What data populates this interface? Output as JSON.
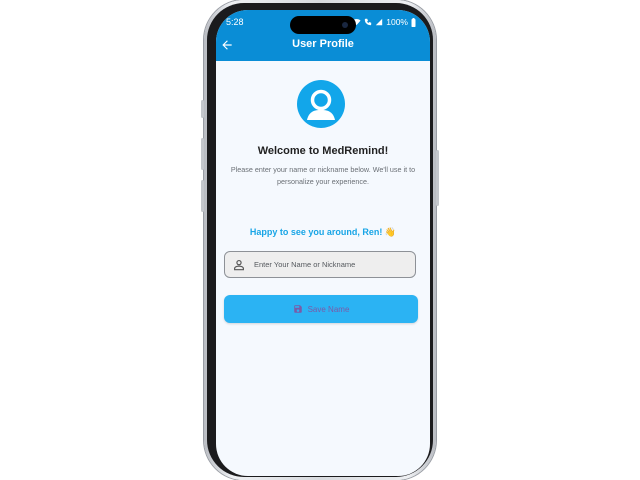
{
  "status_bar": {
    "time": "5:28",
    "battery": "100%"
  },
  "app_bar": {
    "title": "User Profile",
    "back_icon": "arrow-left-icon",
    "color": "#0a8dd6"
  },
  "profile": {
    "avatar_icon": "person-icon",
    "avatar_color": "#12a6ea",
    "welcome_title": "Welcome to MedRemind!",
    "description": "Please enter your name or nickname below. We'll use it to personalize your experience.",
    "greeting": "Happy to see you around, Ren! 👋",
    "greeting_color": "#18a5e6"
  },
  "name_field": {
    "placeholder": "Enter Your Name or Nickname",
    "value": "",
    "icon": "person-outline-icon"
  },
  "save_button": {
    "label": "Save Name",
    "icon": "save-icon",
    "color": "#2bb3f3"
  }
}
